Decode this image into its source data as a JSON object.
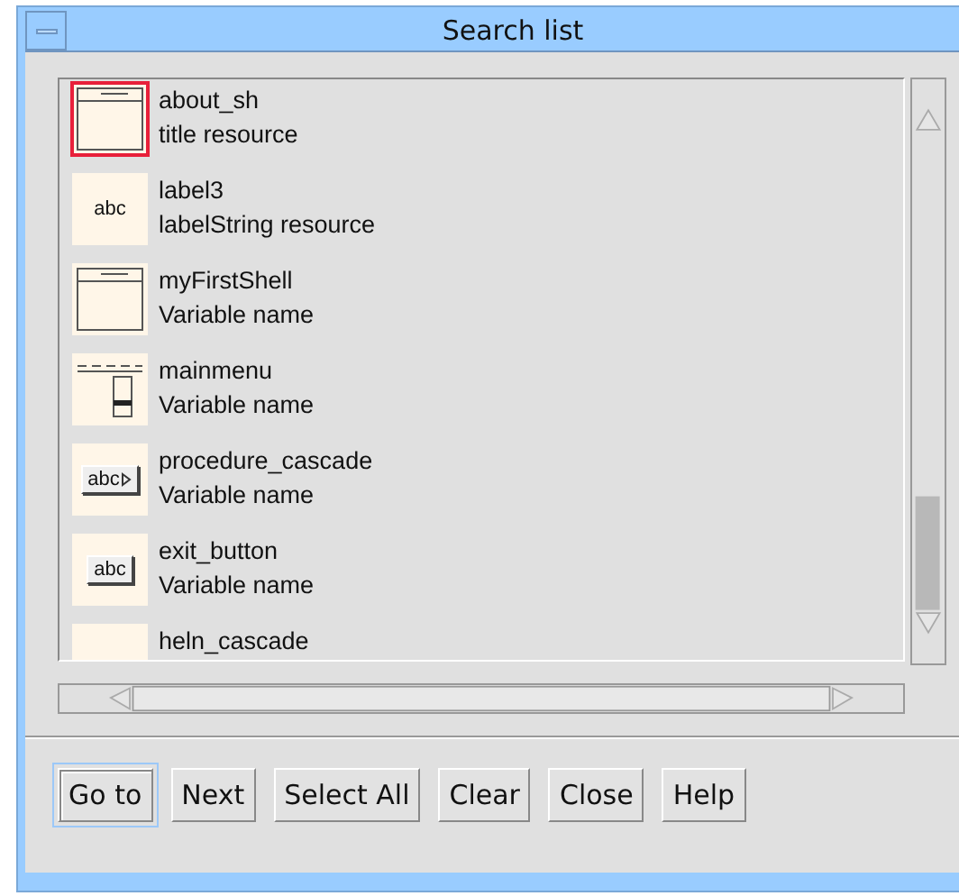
{
  "window": {
    "title": "Search list"
  },
  "items": [
    {
      "name": "about_sh",
      "description": "title resource",
      "kind": "shell",
      "selected": true
    },
    {
      "name": "label3",
      "description": "labelString resource",
      "kind": "label",
      "icon_text": "abc",
      "selected": false
    },
    {
      "name": "myFirstShell",
      "description": "Variable name",
      "kind": "shell",
      "selected": false
    },
    {
      "name": "mainmenu",
      "description": "Variable name",
      "kind": "menu",
      "selected": false
    },
    {
      "name": "procedure_cascade",
      "description": "Variable name",
      "kind": "cascade",
      "icon_text": "abc",
      "selected": false
    },
    {
      "name": "exit_button",
      "description": "Variable name",
      "kind": "button",
      "icon_text": "abc",
      "selected": false
    },
    {
      "name": "heln_cascade",
      "kind": "blank",
      "selected": false
    }
  ],
  "buttons": [
    {
      "label": "Go to",
      "default": true
    },
    {
      "label": "Next",
      "default": false
    },
    {
      "label": "Select All",
      "default": false
    },
    {
      "label": "Clear",
      "default": false
    },
    {
      "label": "Close",
      "default": false
    },
    {
      "label": "Help",
      "default": false
    }
  ]
}
